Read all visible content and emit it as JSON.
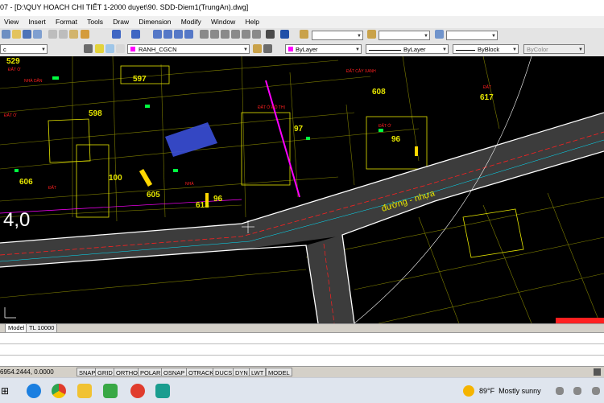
{
  "title": "07 - [D:\\QUY HOACH CHI TIẾT 1-2000 duyet\\90. SDD-Diem1(TrungAn).dwg]",
  "menu": [
    "View",
    "Insert",
    "Format",
    "Tools",
    "Draw",
    "Dimension",
    "Modify",
    "Window",
    "Help"
  ],
  "toolbar2": {
    "left_combo": "c",
    "layer_combo": "RANH_CGCN",
    "color_combo": "ByLayer",
    "linetype_combo": "ByLayer",
    "lineweight_combo": "ByBlock",
    "plotstyle_combo": "ByColor"
  },
  "drawing": {
    "parcels": [
      "529",
      "597",
      "608",
      "617",
      "598",
      "97",
      "96",
      "606",
      "100",
      "605",
      "613",
      "96"
    ],
    "road_label": "đường - nhựa",
    "big_label": "4,0",
    "colors": {
      "background": "#000000",
      "parcel_line": "#e6e600",
      "road_edge": "#ffffff",
      "road_fill": "#4a4a4a",
      "red_text": "#ff2020",
      "magenta": "#ff00ff",
      "cyan": "#00e5ff",
      "green": "#00ff40"
    }
  },
  "tabs": [
    "Model",
    "TL 10000"
  ],
  "status": {
    "coords": "6954.2444, 0.0000",
    "buttons": [
      "SNAP",
      "GRID",
      "ORTHO",
      "POLAR",
      "OSNAP",
      "OTRACK",
      "DUCS",
      "DYN",
      "LWT",
      "MODEL"
    ]
  },
  "taskbar": {
    "weather_temp": "89°F",
    "weather_text": "Mostly sunny",
    "apps": [
      "start-icon",
      "task-view-icon",
      "edge-icon",
      "chrome-icon",
      "file-explorer-icon",
      "app-green-icon",
      "app-red-icon",
      "autocad-icon"
    ]
  }
}
